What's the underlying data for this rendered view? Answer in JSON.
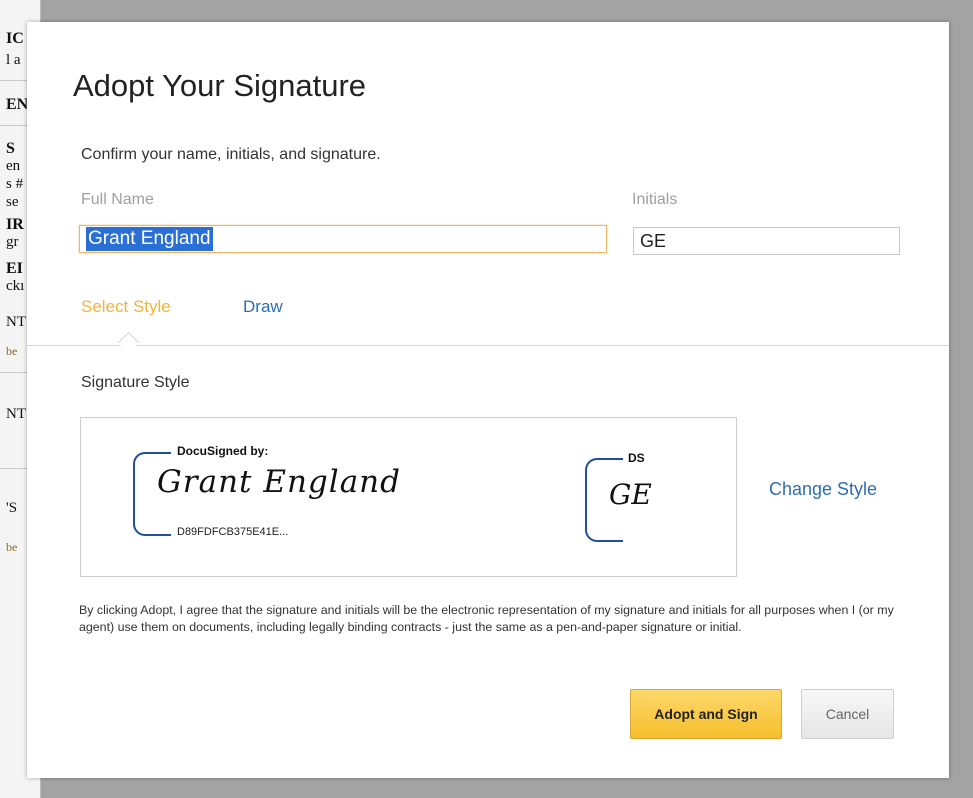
{
  "background_doc": {
    "fragments": [
      "IC",
      "l a",
      "EN",
      "S",
      "en",
      "s #",
      "se",
      "IR",
      "gr",
      "EI",
      "ckı",
      "NT",
      "be",
      "NT",
      "'S",
      "be"
    ]
  },
  "modal": {
    "title": "Adopt Your Signature",
    "subtitle": "Confirm your name, initials, and signature.",
    "full_name_label": "Full Name",
    "full_name_value": "Grant England",
    "initials_label": "Initials",
    "initials_value": "GE",
    "tabs": [
      {
        "label": "Select Style",
        "active": true
      },
      {
        "label": "Draw",
        "active": false
      }
    ],
    "signature_style_label": "Signature Style",
    "signature": {
      "header": "DocuSigned by:",
      "name": "Grant England",
      "id": "D89FDFCB375E41E..."
    },
    "initials_stamp": {
      "header": "DS",
      "text": "GE"
    },
    "change_style_label": "Change Style",
    "legal_text": "By clicking Adopt, I agree that the signature and initials will be the electronic representation of my signature and initials for all purposes when I (or my agent) use them on documents, including legally binding contracts - just the same as a pen-and-paper signature or initial.",
    "adopt_button": "Adopt and Sign",
    "cancel_button": "Cancel"
  },
  "colors": {
    "accent_tab": "#f2b33c",
    "link": "#2e6db4",
    "adopt_button": "#f6bf2d",
    "signature_frame": "#1f4f98"
  }
}
